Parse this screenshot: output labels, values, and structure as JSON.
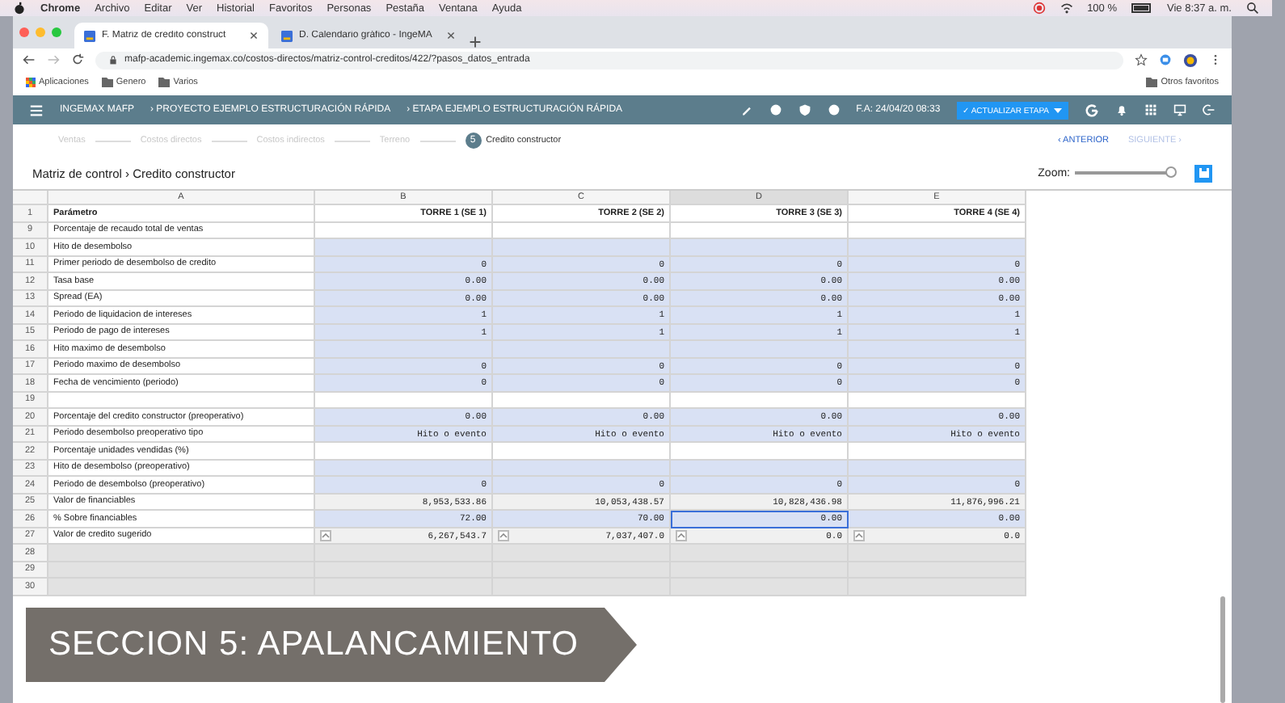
{
  "menubar": {
    "items": [
      "Chrome",
      "Archivo",
      "Editar",
      "Ver",
      "Historial",
      "Favoritos",
      "Personas",
      "Pestaña",
      "Ventana",
      "Ayuda"
    ],
    "battery": "100 %",
    "clock": "Vie 8:37 a. m."
  },
  "browser": {
    "tabs": [
      {
        "title": "F. Matriz de credito construct",
        "selected": true
      },
      {
        "title": "D. Calendario gráfico - IngeMA",
        "selected": false
      }
    ],
    "url": "mafp-academic.ingemax.co/costos-directos/matriz-control-creditos/422/?pasos_datos_entrada",
    "bookmarks": [
      "Aplicaciones",
      "Genero",
      "Varios"
    ],
    "other_bookmarks": "Otros favoritos"
  },
  "app_header": {
    "brand": "INGEMAX MAFP",
    "crumbs": [
      "› PROYECTO EJEMPLO ESTRUCTURACIÓN RÁPIDA",
      "› ETAPA EJEMPLO ESTRUCTURACIÓN RÁPIDA"
    ],
    "date": "F.A: 24/04/20 08:33",
    "update_button": "✓ ACTUALIZAR ETAPA"
  },
  "steps": [
    {
      "label": "Ventas",
      "selected": false
    },
    {
      "label": "Costos directos",
      "selected": false
    },
    {
      "label": "Costos indirectos",
      "selected": false
    },
    {
      "label": "Terreno",
      "selected": false
    },
    {
      "number": "5",
      "label": "Credito constructor",
      "selected": true
    }
  ],
  "nav": {
    "previous": {
      "label": "‹ ANTERIOR",
      "disabled": false
    },
    "next": {
      "label": "SIGUIENTE ›",
      "disabled": true
    }
  },
  "breadcrumb": "Matriz de control › Credito constructor",
  "zoom": {
    "label": "Zoom:",
    "level": 0.98
  },
  "sheet": {
    "columns": [
      {
        "label": "A",
        "selected": false
      },
      {
        "label": "B",
        "selected": false
      },
      {
        "label": "C",
        "selected": false
      },
      {
        "label": "D",
        "selected": true
      },
      {
        "label": "E",
        "selected": false
      }
    ],
    "header_row": {
      "number": "1",
      "cells": [
        "Parámetro",
        "TORRE 1 (SE 1)",
        "TORRE 2 (SE 2)",
        "TORRE 3 (SE 3)",
        "TORRE 4 (SE 4)"
      ]
    },
    "rows": [
      {
        "number": "9",
        "label": "Porcentaje de recaudo total de ventas",
        "kind": "plain"
      },
      {
        "number": "10",
        "label": "Hito de desembolso",
        "kind": "input"
      },
      {
        "number": "11",
        "label": "Primer periodo de desembolso de credito",
        "kind": "input",
        "cells": [
          {
            "text": "0",
            "selected": false
          },
          {
            "text": "0",
            "selected": false
          },
          {
            "text": "0",
            "selected": false
          },
          {
            "text": "0",
            "selected": false
          }
        ]
      },
      {
        "number": "12",
        "label": "Tasa base",
        "kind": "input",
        "cells": [
          {
            "text": "0.00",
            "selected": false
          },
          {
            "text": "0.00",
            "selected": false
          },
          {
            "text": "0.00",
            "selected": false
          },
          {
            "text": "0.00",
            "selected": false
          }
        ]
      },
      {
        "number": "13",
        "label": "Spread (EA)",
        "kind": "input",
        "cells": [
          {
            "text": "0.00",
            "selected": false
          },
          {
            "text": "0.00",
            "selected": false
          },
          {
            "text": "0.00",
            "selected": false
          },
          {
            "text": "0.00",
            "selected": false
          }
        ]
      },
      {
        "number": "14",
        "label": "Periodo de liquidacion de intereses",
        "kind": "input",
        "cells": [
          {
            "text": "1",
            "selected": false
          },
          {
            "text": "1",
            "selected": false
          },
          {
            "text": "1",
            "selected": false
          },
          {
            "text": "1",
            "selected": false
          }
        ]
      },
      {
        "number": "15",
        "label": "Periodo de pago de intereses",
        "kind": "input",
        "cells": [
          {
            "text": "1",
            "selected": false
          },
          {
            "text": "1",
            "selected": false
          },
          {
            "text": "1",
            "selected": false
          },
          {
            "text": "1",
            "selected": false
          }
        ]
      },
      {
        "number": "16",
        "label": "Hito maximo de desembolso",
        "kind": "input"
      },
      {
        "number": "17",
        "label": "Periodo maximo de desembolso",
        "kind": "input",
        "cells": [
          {
            "text": "0",
            "selected": false
          },
          {
            "text": "0",
            "selected": false
          },
          {
            "text": "0",
            "selected": false
          },
          {
            "text": "0",
            "selected": false
          }
        ]
      },
      {
        "number": "18",
        "label": "Fecha de vencimiento (periodo)",
        "kind": "input",
        "cells": [
          {
            "text": "0",
            "selected": false
          },
          {
            "text": "0",
            "selected": false
          },
          {
            "text": "0",
            "selected": false
          },
          {
            "text": "0",
            "selected": false
          }
        ]
      },
      {
        "number": "19",
        "kind": "plain"
      },
      {
        "number": "20",
        "label": "Porcentaje del credito constructor (preoperativo)",
        "kind": "input",
        "cells": [
          {
            "text": "0.00",
            "selected": false
          },
          {
            "text": "0.00",
            "selected": false
          },
          {
            "text": "0.00",
            "selected": false
          },
          {
            "text": "0.00",
            "selected": false
          }
        ]
      },
      {
        "number": "21",
        "label": "Periodo desembolso preoperativo tipo",
        "kind": "input",
        "cells": [
          {
            "text": "Hito o evento",
            "selected": false
          },
          {
            "text": "Hito o evento",
            "selected": false
          },
          {
            "text": "Hito o evento",
            "selected": false
          },
          {
            "text": "Hito o evento",
            "selected": false
          }
        ]
      },
      {
        "number": "22",
        "label": "Porcentaje unidades vendidas (%)",
        "kind": "plain"
      },
      {
        "number": "23",
        "label": "Hito de desembolso (preoperativo)",
        "kind": "input"
      },
      {
        "number": "24",
        "label": "Periodo de desembolso (preoperativo)",
        "kind": "input",
        "cells": [
          {
            "text": "0",
            "selected": false
          },
          {
            "text": "0",
            "selected": false
          },
          {
            "text": "0",
            "selected": false
          },
          {
            "text": "0",
            "selected": false
          }
        ]
      },
      {
        "number": "25",
        "label": "Valor de financiables",
        "kind": "computed",
        "cells": [
          {
            "text": "8,953,533.86",
            "selected": false
          },
          {
            "text": "10,053,438.57",
            "selected": false
          },
          {
            "text": "10,828,436.98",
            "selected": false
          },
          {
            "text": "11,876,996.21",
            "selected": false
          }
        ]
      },
      {
        "number": "26",
        "label": "% Sobre financiables",
        "kind": "input",
        "cells": [
          {
            "text": "72.00",
            "selected": false
          },
          {
            "text": "70.00",
            "selected": false
          },
          {
            "text": "0.00",
            "selected": true
          },
          {
            "text": "0.00",
            "selected": false
          }
        ]
      },
      {
        "number": "27",
        "label": "Valor de credito sugerido",
        "kind": "stepper",
        "cells": [
          {
            "text": "6,267,543.7",
            "selected": false
          },
          {
            "text": "7,037,407.0",
            "selected": false
          },
          {
            "text": "0.0",
            "selected": false
          },
          {
            "text": "0.0",
            "selected": false
          }
        ]
      },
      {
        "number": "28",
        "kind": "empty"
      },
      {
        "number": "29",
        "kind": "empty"
      },
      {
        "number": "30",
        "kind": "empty"
      }
    ]
  },
  "overlay_caption": "SECCION 5: APALANCAMIENTO"
}
